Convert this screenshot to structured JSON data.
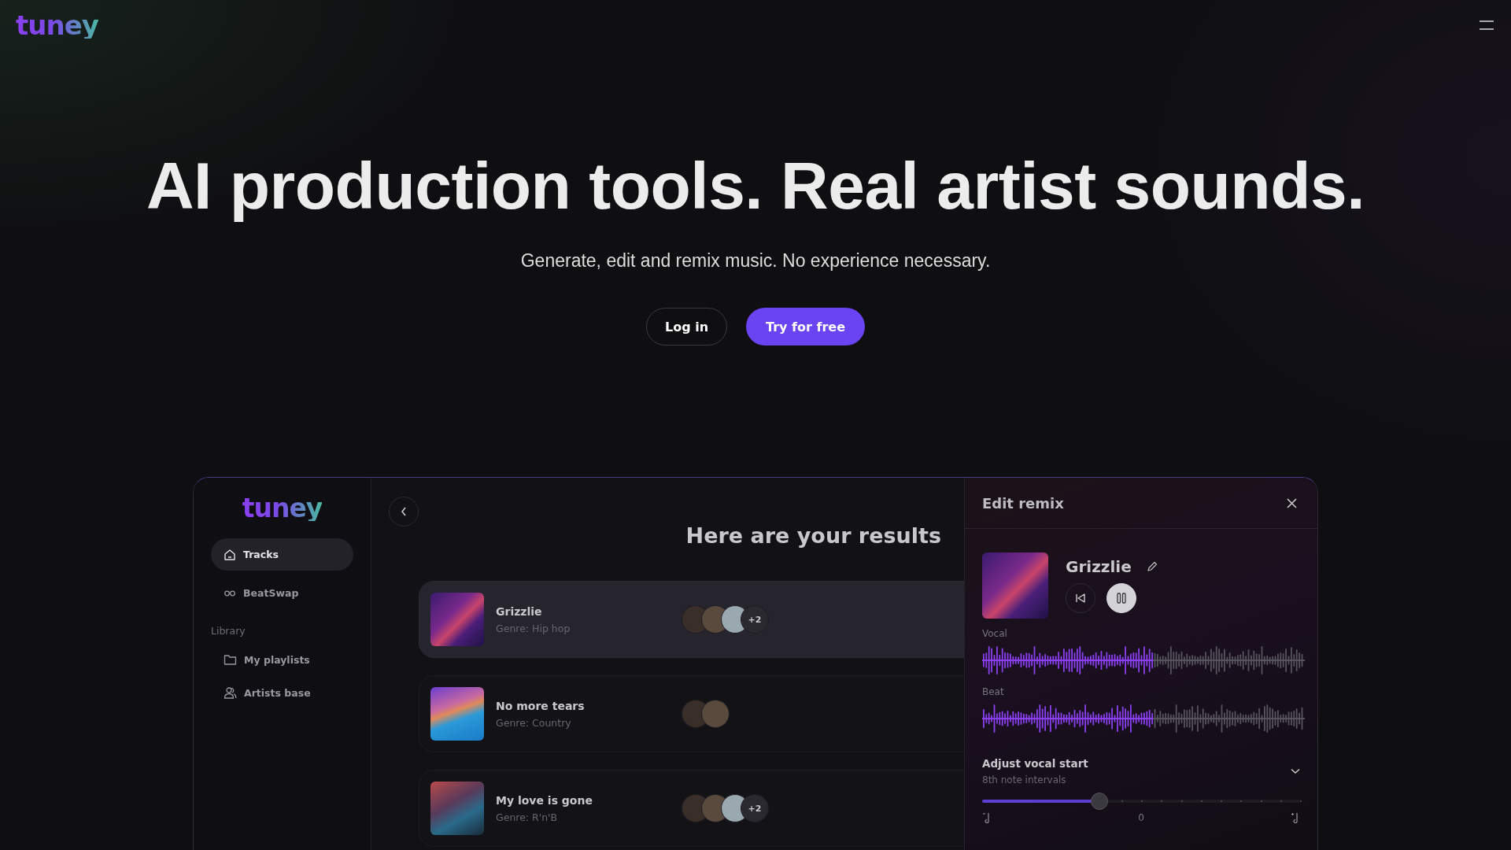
{
  "header": {
    "logo": "tuney"
  },
  "hero": {
    "title": "AI production tools. Real artist sounds.",
    "subtitle": "Generate, edit and remix music. No experience necessary.",
    "buttons": [
      {
        "label": "Log in",
        "kind": "outline"
      },
      {
        "label": "Try for free",
        "kind": "primary"
      }
    ]
  },
  "app": {
    "logo": "tuney",
    "nav": [
      {
        "label": "Tracks",
        "selected": true
      },
      {
        "label": "BeatSwap",
        "selected": false
      }
    ],
    "library": {
      "title": "Library",
      "items": [
        {
          "label": "My playlists",
          "selected": false
        },
        {
          "label": "Artists base",
          "selected": false
        }
      ]
    },
    "results": {
      "title": "Here are your results",
      "tracks": [
        {
          "title": "Grizzlie",
          "genre": "Genre: Hip hop",
          "selected": true,
          "artists": [
            {
              "kind": "photo"
            },
            {
              "kind": "photo"
            },
            {
              "kind": "photo"
            }
          ],
          "more": "+2"
        },
        {
          "title": "No more tears",
          "genre": "Genre: Country",
          "selected": false,
          "artists": [
            {
              "kind": "photo"
            },
            {
              "kind": "photo"
            }
          ]
        },
        {
          "title": "My love is gone",
          "genre": "Genre: R'n'B",
          "selected": false,
          "artists": [
            {
              "kind": "photo"
            },
            {
              "kind": "photo"
            },
            {
              "kind": "photo"
            }
          ],
          "more": "+2"
        }
      ]
    },
    "editor": {
      "title": "Edit remix",
      "track": {
        "title": "Grizzlie"
      },
      "player": {
        "playing": true
      },
      "stems": [
        {
          "label": "Vocal",
          "level": 0.53
        },
        {
          "label": "Beat",
          "level": 0.53
        }
      ],
      "adjust": {
        "title": "Adjust vocal start",
        "subtitle": "8th note intervals",
        "level": 0.37,
        "value_label": "0"
      }
    }
  }
}
